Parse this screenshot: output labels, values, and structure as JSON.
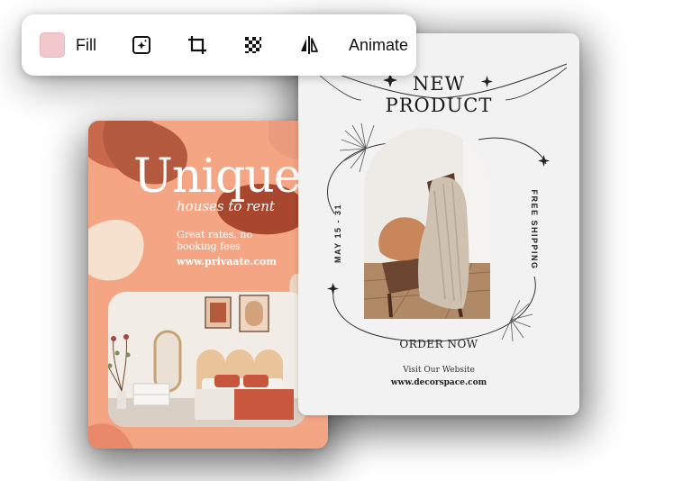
{
  "toolbar": {
    "fill_label": "Fill",
    "fill_color": "#f3c8cd",
    "tools": [
      "magic-edit-icon",
      "crop-icon",
      "transparency-icon",
      "flip-icon"
    ],
    "animate_label": "Animate"
  },
  "left_card": {
    "title": "Unique",
    "subtitle": "houses     to rent",
    "tagline": "Great rates, no booking fees",
    "website": "www.privaate.com",
    "background_color": "#f4a584"
  },
  "right_card": {
    "title_line1": "NEW",
    "title_line2": "PRODUCT",
    "date_text": "MAY 15 - 31",
    "shipping_text": "FREE SHIPPING",
    "order_label": "ORDER NOW",
    "visit_label": "Visit Our Website",
    "website": "www.decorspace.com",
    "background_color": "#f2f2f2"
  }
}
